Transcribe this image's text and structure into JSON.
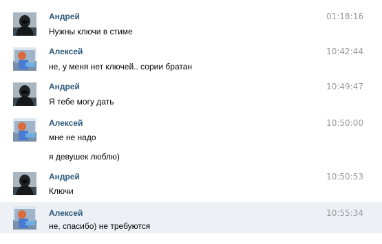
{
  "messages": [
    {
      "author": "Андрей",
      "avatar": "andrey-avatar",
      "time": "01:18:16",
      "lines": [
        "Нужны ключи в стиме"
      ]
    },
    {
      "author": "Алексей",
      "avatar": "alexey-avatar",
      "time": "10:42:44",
      "lines": [
        "не, у меня нет ключей.. сории братан"
      ]
    },
    {
      "author": "Андрей",
      "avatar": "andrey-avatar",
      "time": "10:49:47",
      "lines": [
        "Я тебе могу дать"
      ]
    },
    {
      "author": "Алексей",
      "avatar": "alexey-avatar",
      "time": "10:50:00",
      "lines": [
        "мне не надо",
        "я девушек  люблю)"
      ]
    },
    {
      "author": "Андрей",
      "avatar": "andrey-avatar",
      "time": "10:50:53",
      "lines": [
        "Ключи"
      ]
    },
    {
      "author": "Алексей",
      "avatar": "alexey-avatar",
      "time": "10:55:34",
      "lines": [
        "не, спасибо) не требуются"
      ],
      "highlighted": true
    }
  ],
  "colors": {
    "author": "#2b587a",
    "time": "#999999",
    "highlight": "#edf1f5"
  }
}
